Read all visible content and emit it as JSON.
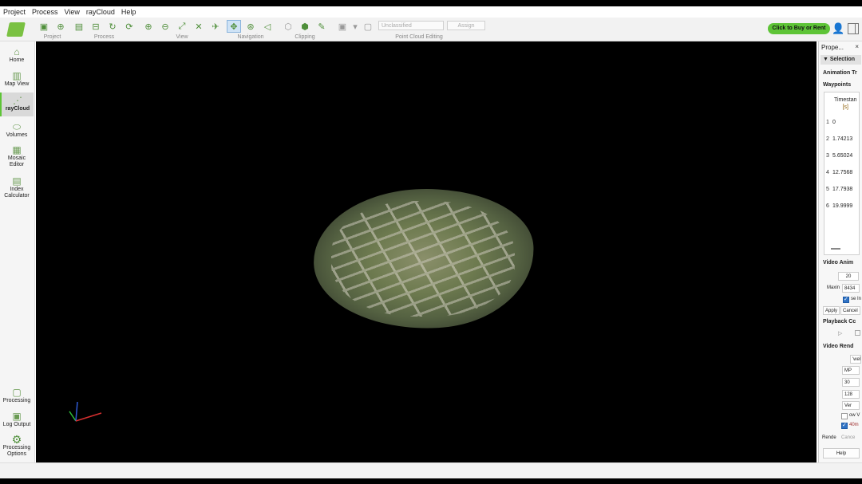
{
  "menu": [
    "Project",
    "Process",
    "View",
    "rayCloud",
    "Help"
  ],
  "toolbar": {
    "groups": [
      {
        "label": "Project"
      },
      {
        "label": "Process"
      },
      {
        "label": "View"
      },
      {
        "label": "Navigation"
      },
      {
        "label": "Clipping"
      },
      {
        "label": "Point Cloud Editing"
      }
    ],
    "class_select_value": "Unclassified",
    "assign_label": "Assign",
    "buy_label": "Click to Buy or Rent"
  },
  "sidebar": {
    "items": [
      {
        "label": "Home",
        "icon": "home-icon",
        "glyph": "⌂"
      },
      {
        "label": "Map View",
        "icon": "map-icon",
        "glyph": "▥"
      },
      {
        "label": "rayCloud",
        "icon": "raycloud-icon",
        "glyph": "⋰"
      },
      {
        "label": "Volumes",
        "icon": "volumes-icon",
        "glyph": "⬭"
      },
      {
        "label": "Mosaic Editor",
        "icon": "mosaic-icon",
        "glyph": "▦"
      },
      {
        "label": "Index Calculator",
        "icon": "index-calculator-icon",
        "glyph": "▤"
      }
    ],
    "bottom": [
      {
        "label": "Processing",
        "icon": "processing-icon",
        "glyph": "▢"
      },
      {
        "label": "Log Output",
        "icon": "log-output-icon",
        "glyph": "▣"
      },
      {
        "label": "Processing Options",
        "icon": "gear-icon",
        "glyph": "⚙"
      }
    ]
  },
  "properties": {
    "title": "Prope...",
    "close": "×",
    "selection_label": "Selection",
    "animation_label": "Animation Tr",
    "waypoints_label": "Waypoints",
    "timestamp_header": "Timestan",
    "timestamp_unit": "[s]",
    "waypoints": [
      {
        "index": "1",
        "value": "0"
      },
      {
        "index": "2",
        "value": "1.74213"
      },
      {
        "index": "3",
        "value": "5.65024"
      },
      {
        "index": "4",
        "value": "12.7568"
      },
      {
        "index": "5",
        "value": "17.7938"
      },
      {
        "index": "6",
        "value": "19.9999"
      }
    ],
    "video_anim_label": "Video Anim",
    "frames_value": "20",
    "max_label": "Maxin",
    "max_value": "8434",
    "check1_label": "se In",
    "apply_label": "Apply",
    "cancel_label": "Cancel",
    "playback_label": "Playback Cc",
    "video_render_label": "Video Rend",
    "path_value": "'wel",
    "format_value": "MP",
    "fps_value": "30",
    "res_value": "128",
    "quality_value": "Ver",
    "show_label": "ow V",
    "check2_label": "40m",
    "render_label": "Rende",
    "render_cancel_label": "Cance",
    "help_label": "Help"
  }
}
